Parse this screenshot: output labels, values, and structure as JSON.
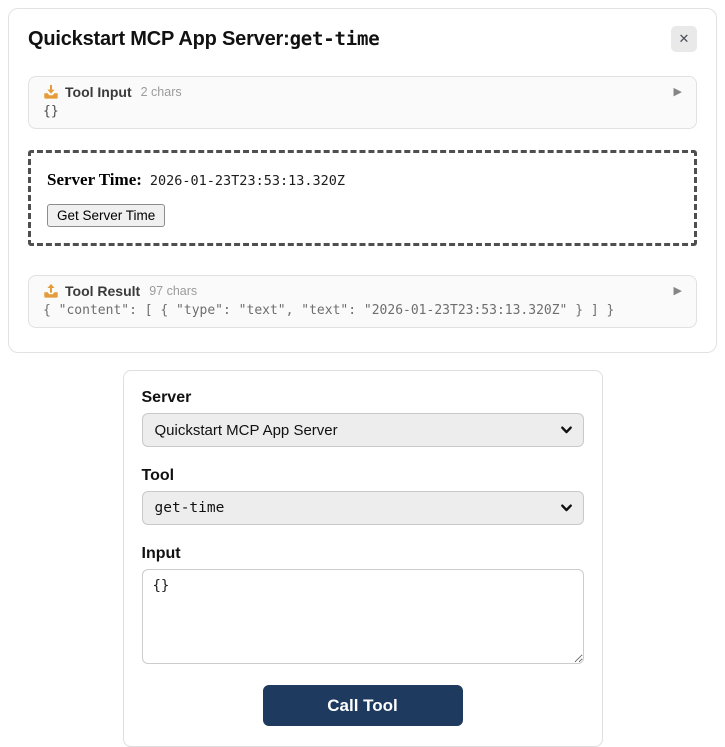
{
  "card": {
    "title_server": "Quickstart MCP App Server:",
    "title_tool": "get-time",
    "close_glyph": "✕",
    "expand_glyph": "▶",
    "tool_input": {
      "label": "Tool Input",
      "chars": "2 chars",
      "content": "{}"
    },
    "app_view": {
      "server_time_label": "Server Time:",
      "server_time_value": "2026-01-23T23:53:13.320Z",
      "button_label": "Get Server Time"
    },
    "tool_result": {
      "label": "Tool Result",
      "chars": "97 chars",
      "content": "{ \"content\": [ { \"type\": \"text\", \"text\": \"2026-01-23T23:53:13.320Z\" } ] }"
    }
  },
  "form": {
    "server_label": "Server",
    "server_value": "Quickstart MCP App Server",
    "tool_label": "Tool",
    "tool_value": "get-time",
    "input_label": "Input",
    "input_value": "{}",
    "call_button_label": "Call Tool"
  },
  "colors": {
    "accent_navy": "#1e3a5f",
    "icon_orange": "#e49b38",
    "dashed_border": "#4f4f4f"
  }
}
